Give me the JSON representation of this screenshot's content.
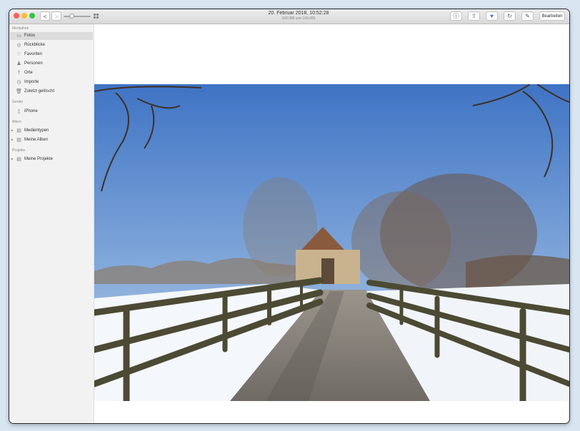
{
  "window": {
    "title": "20. Februar 2018, 10:52:28",
    "subtitle": "169.086 von 169.086",
    "edit_label": "Bearbeiten"
  },
  "toolbar": {
    "back_glyph": "<",
    "forward_glyph": ">",
    "info_glyph": "ⓘ",
    "share_glyph": "⇧",
    "favorite_glyph": "♥",
    "rotate_glyph": "↻",
    "enhance_glyph": "✎"
  },
  "sidebar": {
    "sections": {
      "library": "Mediathek",
      "devices": "Geräte",
      "albums": "Alben",
      "projects": "Projekte"
    },
    "library_items": [
      {
        "label": "Fotos",
        "icon": "photos-icon",
        "glyph": "▭"
      },
      {
        "label": "Rückblicke",
        "icon": "memories-icon",
        "glyph": "◎"
      },
      {
        "label": "Favoriten",
        "icon": "heart-icon",
        "glyph": "♡"
      },
      {
        "label": "Personen",
        "icon": "person-icon",
        "glyph": "♟"
      },
      {
        "label": "Orte",
        "icon": "pin-icon",
        "glyph": "†"
      },
      {
        "label": "Importe",
        "icon": "clock-icon",
        "glyph": "◷"
      },
      {
        "label": "Zuletzt gelöscht",
        "icon": "trash-icon",
        "glyph": "🗑"
      }
    ],
    "device_items": [
      {
        "label": "iPhone",
        "icon": "iphone-icon",
        "glyph": "▯"
      }
    ],
    "album_items": [
      {
        "label": "Medientypen",
        "icon": "folder-icon",
        "glyph": "▤"
      },
      {
        "label": "Meine Alben",
        "icon": "folder-icon",
        "glyph": "▤"
      }
    ],
    "project_items": [
      {
        "label": "Meine Projekte",
        "icon": "folder-icon",
        "glyph": "▤"
      }
    ],
    "disclosure_glyph": "▸"
  }
}
